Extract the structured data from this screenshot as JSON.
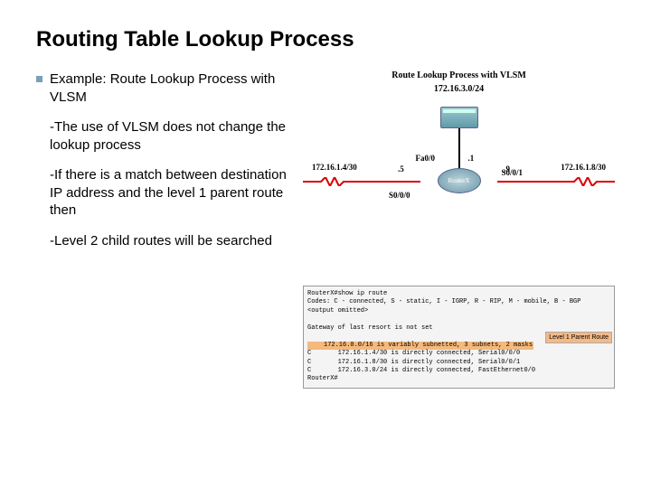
{
  "title": "Routing Table Lookup Process",
  "bullet_main": "Example: Route Lookup Process with VLSM",
  "sub1": "-The use of VLSM does not change the lookup process",
  "sub2": "-If there is a match between destination IP address and the level 1 parent route then",
  "sub3": "-Level 2 child routes will be searched",
  "diagram": {
    "title": "Route Lookup Process with VLSM",
    "top_subnet": "172.16.3.0/24",
    "fa_label": "Fa0/0",
    "fa_ip": ".1",
    "s000_label": "S0/0/0",
    "s000_near_ip": ".5",
    "s001_label": "S0/0/1",
    "s001_near_ip": ".9",
    "left_subnet": "172.16.1.4/30",
    "right_subnet": "172.16.1.8/30",
    "router_name": "RouterX"
  },
  "cli": {
    "prompt": "RouterX#",
    "cmd": "show ip route",
    "codes": "Codes: C - connected, S - static, I - IGRP, R - RIP, M - mobile, B - BGP",
    "omitted": "<output omitted>",
    "gw": "Gateway of last resort is not set",
    "parent": "172.16.0.0/16 is variably subnetted, 3 subnets, 2 masks",
    "c1": "C       172.16.1.4/30 is directly connected, Serial0/0/0",
    "c2": "C       172.16.1.8/30 is directly connected, Serial0/0/1",
    "c3": "C       172.16.3.0/24 is directly connected, FastEthernet0/0",
    "end": "RouterX#",
    "parent_label": "Level 1 Parent Route"
  }
}
